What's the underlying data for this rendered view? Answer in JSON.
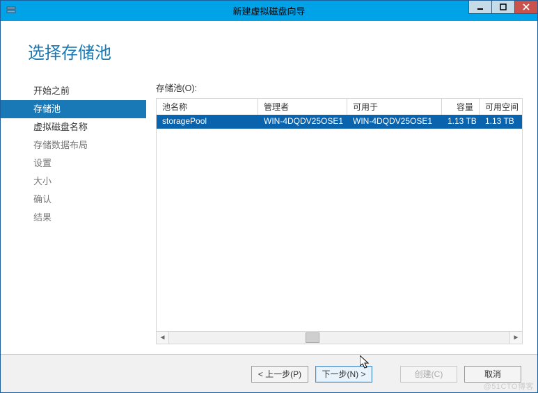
{
  "window": {
    "title": "新建虚拟磁盘向导"
  },
  "heading": "选择存储池",
  "steps": {
    "before": "开始之前",
    "pool": "存储池",
    "vdname": "虚拟磁盘名称",
    "layout": "存储数据布局",
    "settings": "设置",
    "size": "大小",
    "confirm": "确认",
    "result": "结果"
  },
  "list": {
    "label": "存储池(O):",
    "columns": {
      "name": "池名称",
      "manager": "管理者",
      "available_to": "可用于",
      "capacity": "容量",
      "free": "可用空间"
    },
    "rows": [
      {
        "name": "storagePool",
        "manager": "WIN-4DQDV25OSE1",
        "available_to": "WIN-4DQDV25OSE1",
        "capacity": "1.13 TB",
        "free": "1.13 TB"
      }
    ]
  },
  "buttons": {
    "prev": "< 上一步(P)",
    "next": "下一步(N) >",
    "create": "创建(C)",
    "cancel": "取消"
  },
  "watermark": "@51CTO博客"
}
